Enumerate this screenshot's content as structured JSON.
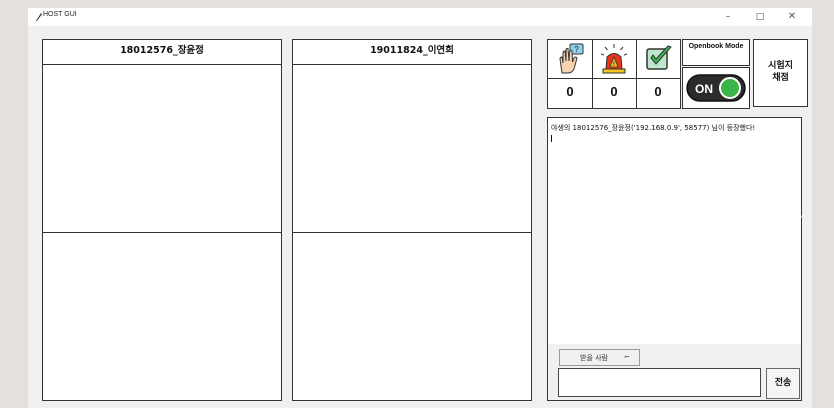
{
  "window": {
    "title": "HOST GUI",
    "minimize_glyph": "–",
    "maximize_glyph": "□",
    "close_glyph": "✕"
  },
  "students": [
    {
      "name": "18012576_장윤정"
    },
    {
      "name": "19011824_이연희"
    }
  ],
  "status": {
    "icons": [
      "raise-hand-question-icon",
      "alarm-siren-icon",
      "checkbox-checked-icon"
    ],
    "counts": [
      "0",
      "0",
      "0"
    ]
  },
  "openbook": {
    "label": "Openbook Mode",
    "toggle_text": "ON",
    "state": "on"
  },
  "grade_button": {
    "line1": "시험지",
    "line2": "채점"
  },
  "log": {
    "lines": [
      "야생의 18012576_장윤정('192.168.0.9', 58577) 님이 등장했다!"
    ]
  },
  "recipient": {
    "label": "받을 사람",
    "arrow": "⌐"
  },
  "message": {
    "value": "",
    "send_label": "전송"
  },
  "nav": {
    "prev": "‹",
    "next": "›"
  },
  "colors": {
    "toggle_green": "#39b54a",
    "toggle_dark": "#2b2b2b",
    "alarm_red": "#e8341c",
    "alarm_yellow": "#f7c51e"
  }
}
